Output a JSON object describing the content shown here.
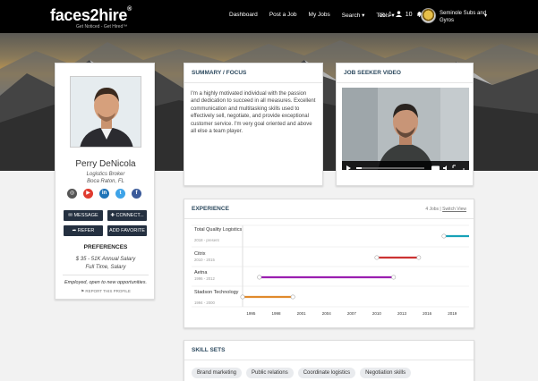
{
  "brand": {
    "logo_a": "faces",
    "logo_b": "2",
    "logo_c": "hire",
    "logo_mark": "®",
    "tagline": "Get Noticed - Get Hired™"
  },
  "nav": {
    "links": [
      "Dashboard",
      "Post a Job",
      "My Jobs",
      "Search ▾",
      "Tools ▾"
    ],
    "messages": "1",
    "people": "10",
    "alerts": "0",
    "company_line1": "Seminole Subs and",
    "company_line2": "Gyros",
    "caret": "▾"
  },
  "profile": {
    "name": "Perry DeNicola",
    "title": "Logistics Broker",
    "location": "Boca Raton, FL",
    "socials": [
      {
        "icon": "instagram-icon",
        "glyph": "◎",
        "color": "#555555"
      },
      {
        "icon": "youtube-icon",
        "glyph": "▶",
        "color": "#e03b2f"
      },
      {
        "icon": "linkedin-icon",
        "glyph": "in",
        "color": "#1f73b7"
      },
      {
        "icon": "twitter-icon",
        "glyph": "t",
        "color": "#3ea3e8"
      },
      {
        "icon": "facebook-icon",
        "glyph": "f",
        "color": "#3b5b9a"
      }
    ],
    "buttons": {
      "message": "✉ MESSAGE",
      "connect": "✚ CONNECT...",
      "refer": "➦ REFER",
      "favorite": "ADD FAVORITE"
    },
    "preferences_title": "PREFERENCES",
    "salary": "$ 35 - 51K Annual Salary",
    "type": "Full Time, Salary",
    "status": "Employed, open to new opportunities.",
    "report": "⚑ REPORT THIS PROFILE"
  },
  "summary": {
    "title": "SUMMARY / FOCUS",
    "text": "I'm a highly motivated individual with the passion and dedication to succeed in all measures. Excellent communication and multitasking skills used to effectively sell, negotiate, and provide exceptional customer service. I'm very goal oriented and above all else a team player."
  },
  "video": {
    "title": "JOB SEEKER VIDEO"
  },
  "experience": {
    "title": "EXPERIENCE",
    "count": "4 Jobs |",
    "switch": "Switch View",
    "jobs": [
      {
        "company": "Total Quality Logistics",
        "years": "2018 - present",
        "start": 2018,
        "end": 2021,
        "color": "#17a2b8"
      },
      {
        "company": "Citrix",
        "years": "2010 - 2015",
        "start": 2010,
        "end": 2015,
        "color": "#cc3333"
      },
      {
        "company": "Aetna",
        "years": "1996 - 2012",
        "start": 1996,
        "end": 2012,
        "color": "#9b1fb0"
      },
      {
        "company": "Stadson Technology",
        "years": "1994 - 2000",
        "start": 1994,
        "end": 2000,
        "color": "#e08a2c"
      }
    ],
    "axis_years": [
      "1995",
      "1998",
      "2001",
      "2004",
      "2007",
      "2010",
      "2013",
      "2016",
      "2019"
    ],
    "axis_min": 1994,
    "axis_max": 2021
  },
  "skills": {
    "title": "SKILL SETS",
    "items": [
      "Brand marketing",
      "Public relations",
      "Coordinate logistics",
      "Negotiation skills"
    ]
  }
}
